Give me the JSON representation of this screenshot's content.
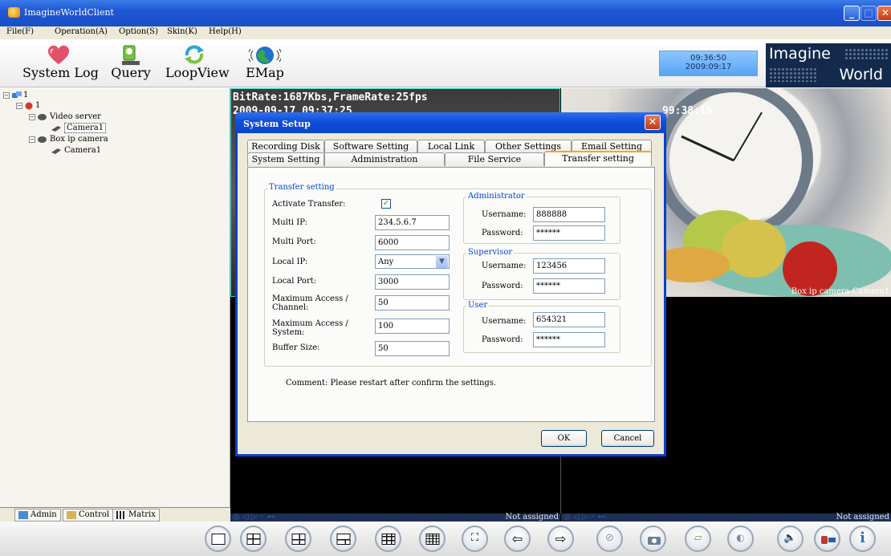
{
  "window": {
    "title": "ImagineWorldClient"
  },
  "menu": [
    "File(F)",
    "Operation(A)",
    "Option(S)",
    "Skin(K)",
    "Help(H)"
  ],
  "toolbar": {
    "buttons": [
      {
        "label": "System Log",
        "icon": "heart-icon"
      },
      {
        "label": "Query",
        "icon": "person-search-icon"
      },
      {
        "label": "LoopView",
        "icon": "loop-arrows-icon"
      },
      {
        "label": "EMap",
        "icon": "globe-icon"
      }
    ]
  },
  "clock": {
    "time": "09:36:50",
    "date": "2009:09:17"
  },
  "brand": {
    "line1": "Imagine",
    "line2": "World"
  },
  "tree": {
    "root": "1",
    "site": "1",
    "video_server": "Video server",
    "video_server_camera": "Camera1",
    "box_camera": "Box ip camera",
    "box_camera_camera": "Camera1"
  },
  "tree_tabs": [
    "Admin",
    "Control",
    "Matrix"
  ],
  "video": {
    "osd_bitrate": "BitRate:1687Kbs,FrameRate:25fps",
    "osd_date_left": "2009-09-17 09:37:25",
    "osd_time_right": "99:38:16",
    "label_right": "Box ip camera-Camera1",
    "status_left": "Not assigned",
    "status_right": "Not assigned"
  },
  "dialog": {
    "title": "System Setup",
    "tabs_row1": [
      "Recording Disk",
      "Software Setting",
      "Local Link",
      "Other Settings",
      "Email Setting"
    ],
    "tabs_row2": [
      "System Setting",
      "Administration",
      "File Service",
      "Transfer setting"
    ],
    "active_tab": "Transfer setting",
    "transfer": {
      "legend": "Transfer setting",
      "activate_label": "Activate Transfer:",
      "activate_checked": true,
      "multi_ip_label": "Multi IP:",
      "multi_ip": "234.5.6.7",
      "multi_port_label": "Multi Port:",
      "multi_port": "6000",
      "local_ip_label": "Local IP:",
      "local_ip": "Any",
      "local_port_label": "Local Port:",
      "local_port": "3000",
      "max_channel_label": "Maximum Access / Channel:",
      "max_channel": "50",
      "max_system_label": "Maximum Access / System:",
      "max_system": "100",
      "buffer_label": "Buffer Size:",
      "buffer": "50"
    },
    "administrator": {
      "legend": "Administrator",
      "username_label": "Username:",
      "username": "888888",
      "password_label": "Password:",
      "password": "******"
    },
    "supervisor": {
      "legend": "Supervisor",
      "username_label": "Username:",
      "username": "123456",
      "password_label": "Password:",
      "password": "******"
    },
    "user": {
      "legend": "User",
      "username_label": "Username:",
      "username": "654321",
      "password_label": "Password:",
      "password": "******"
    },
    "comment": "Comment: Please restart after confirm the settings.",
    "ok": "OK",
    "cancel": "Cancel"
  },
  "colors": {
    "titlebar": "#1f57d6",
    "dialog_border": "#0a3fd0",
    "accent_tab": "#f5a623",
    "legend": "#0046d5"
  }
}
